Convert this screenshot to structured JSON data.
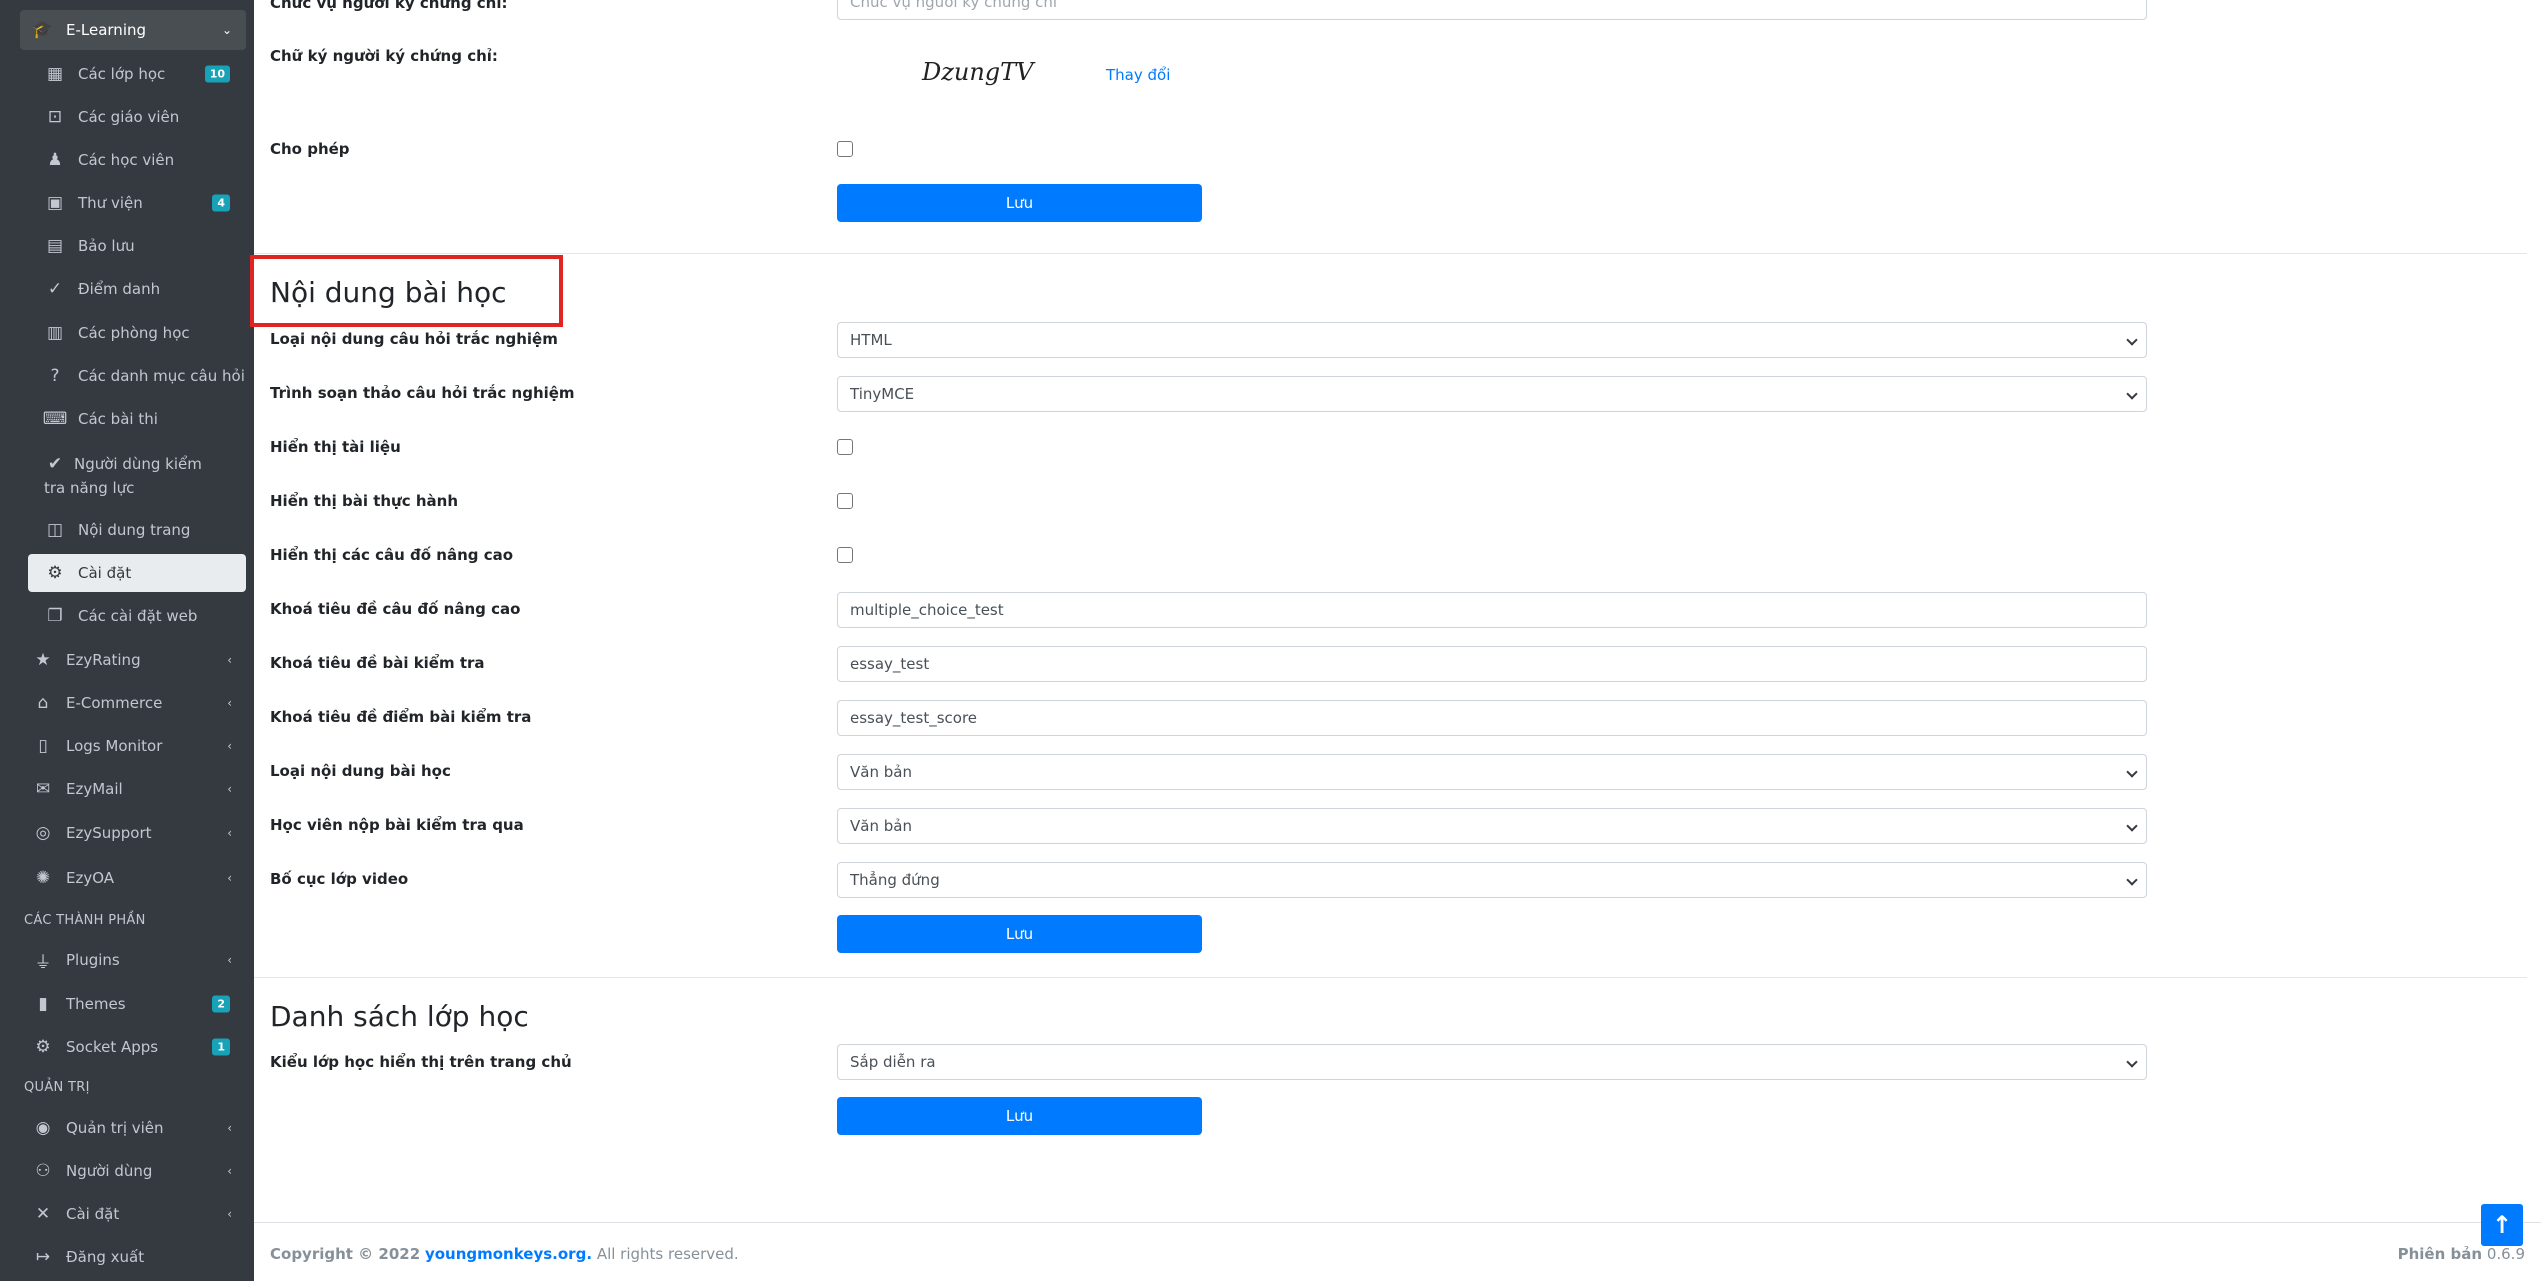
{
  "sidebar": {
    "elearning": {
      "label": "E-Learning"
    },
    "elearning_items": [
      {
        "label": "Các lớp học",
        "badge": "10",
        "icon": "th-large-icon"
      },
      {
        "label": "Các giáo viên",
        "icon": "chalkboard-teacher-icon"
      },
      {
        "label": "Các học viên",
        "icon": "user-graduate-icon"
      },
      {
        "label": "Thư viện",
        "badge": "4",
        "icon": "photo-video-icon"
      },
      {
        "label": "Bảo lưu",
        "icon": "archive-icon"
      },
      {
        "label": "Điểm danh",
        "icon": "user-check-icon"
      },
      {
        "label": "Các phòng học",
        "icon": "building-icon"
      },
      {
        "label": "Các danh mục câu hỏi",
        "icon": "question-icon"
      },
      {
        "label": "Các bài thi",
        "icon": "keyboard-icon"
      },
      {
        "label": "Người dùng kiểm tra năng lực",
        "icon": "check-double-icon"
      },
      {
        "label": "Nội dung trang",
        "icon": "columns-icon"
      },
      {
        "label": "Cài đặt",
        "icon": "cogs-icon"
      },
      {
        "label": "Các cài đặt web",
        "icon": "window-restore-icon"
      }
    ],
    "modules": [
      {
        "label": "EzyRating",
        "icon": "star-icon"
      },
      {
        "label": "E-Commerce",
        "icon": "shopping-basket-icon"
      },
      {
        "label": "Logs Monitor",
        "icon": "file-alt-icon"
      },
      {
        "label": "EzyMail",
        "icon": "envelope-icon"
      },
      {
        "label": "EzySupport",
        "icon": "life-ring-icon"
      },
      {
        "label": "EzyOA",
        "icon": "cog-icon"
      }
    ],
    "components_header": "CÁC THÀNH PHẦN",
    "components": [
      {
        "label": "Plugins",
        "icon": "plug-icon"
      },
      {
        "label": "Themes",
        "badge": "2",
        "icon": "paint-brush-icon"
      },
      {
        "label": "Socket Apps",
        "badge": "1",
        "icon": "cogs-icon"
      }
    ],
    "admin_header": "QUẢN TRỊ",
    "admin": [
      {
        "label": "Quản trị viên",
        "icon": "user-circle-icon"
      },
      {
        "label": "Người dùng",
        "icon": "users-icon"
      },
      {
        "label": "Cài đặt",
        "icon": "tools-icon"
      },
      {
        "label": "Đăng xuất",
        "icon": "sign-out-icon"
      }
    ]
  },
  "certificate": {
    "signer_title_label": "Chức vụ người ký chứng chỉ:",
    "signer_title_placeholder": "Chức vụ người ký chứng chỉ",
    "signature_label": "Chữ ký người ký chứng chỉ:",
    "signature_text": "DzungTV",
    "change_link": "Thay đổi",
    "allow_label": "Cho phép",
    "save": "Lưu"
  },
  "lesson_content": {
    "title": "Nội dung bài học",
    "fields": {
      "quiz_content_type_label": "Loại nội dung câu hỏi trắc nghiệm",
      "quiz_content_type_value": "HTML",
      "quiz_editor_label": "Trình soạn thảo câu hỏi trắc nghiệm",
      "quiz_editor_value": "TinyMCE",
      "show_documents_label": "Hiển thị tài liệu",
      "show_practice_label": "Hiển thị bài thực hành",
      "show_advanced_label": "Hiển thị các câu đố nâng cao",
      "advanced_title_key_label": "Khoá tiêu đề câu đố nâng cao",
      "advanced_title_key_value": "multiple_choice_test",
      "test_title_key_label": "Khoá tiêu đề bài kiểm tra",
      "test_title_key_value": "essay_test",
      "test_score_key_label": "Khoá tiêu đề điểm bài kiểm tra",
      "test_score_key_value": "essay_test_score",
      "lesson_type_label": "Loại nội dung bài học",
      "lesson_type_value": "Văn bản",
      "submit_via_label": "Học viên nộp bài kiểm tra qua",
      "submit_via_value": "Văn bản",
      "video_layout_label": "Bố cục lớp video",
      "video_layout_value": "Thẳng đứng"
    },
    "save": "Lưu"
  },
  "class_list": {
    "title": "Danh sách lớp học",
    "homepage_type_label": "Kiểu lớp học hiển thị trên trang chủ",
    "homepage_type_value": "Sắp diễn ra",
    "save": "Lưu"
  },
  "footer": {
    "copyright": "Copyright © 2022",
    "site": "youngmonkeys.org.",
    "rights": "All rights reserved.",
    "version_label": "Phiên bản",
    "version": "0.6.9"
  },
  "colors": {
    "primary": "#007bff",
    "sidebar_bg": "#343a40",
    "badge": "#17a2b8",
    "highlight": "#e02424"
  }
}
